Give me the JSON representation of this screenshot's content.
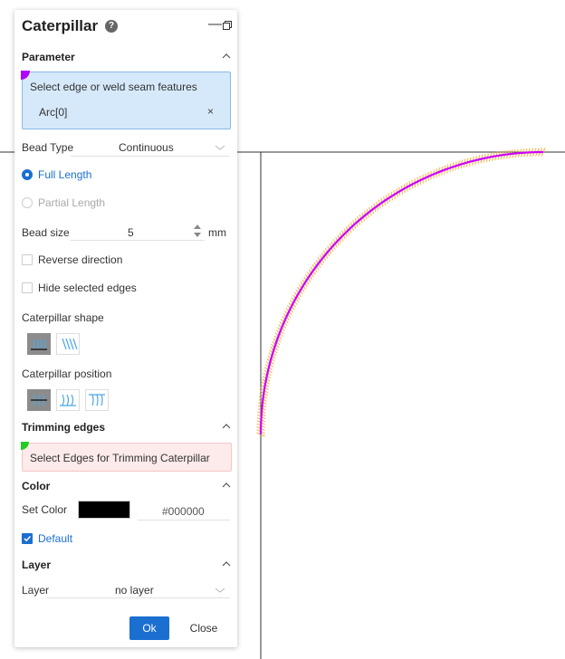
{
  "panel": {
    "title": "Caterpillar",
    "help_icon": "?",
    "minimize_icon": "—",
    "parameter": {
      "title": "Parameter",
      "select_prompt": "Select edge or weld seam features",
      "selected_item": "Arc[0]",
      "remove_icon": "×",
      "bead_type_label": "Bead Type",
      "bead_type_value": "Continuous",
      "full_length_label": "Full Length",
      "partial_length_label": "Partial Length",
      "bead_size_label": "Bead size",
      "bead_size_value": "5",
      "bead_size_unit": "mm",
      "reverse_direction_label": "Reverse direction",
      "hide_selected_edges_label": "Hide selected edges",
      "shape_label": "Caterpillar shape",
      "position_label": "Caterpillar position"
    },
    "trimming": {
      "title": "Trimming edges",
      "prompt": "Select Edges for Trimming Caterpillar"
    },
    "color": {
      "title": "Color",
      "set_color_label": "Set Color",
      "hex_value": "#000000",
      "swatch_color": "#000000",
      "default_label": "Default"
    },
    "layer": {
      "title": "Layer",
      "layer_label": "Layer",
      "layer_value": "no layer"
    },
    "ok_label": "Ok",
    "close_label": "Close"
  },
  "colors": {
    "accent": "#1a6fd1",
    "selection_bg": "#d6e9fb",
    "trim_bg": "#fdeaea",
    "arc": "#cc00ff",
    "hatch": "#f5b042"
  }
}
